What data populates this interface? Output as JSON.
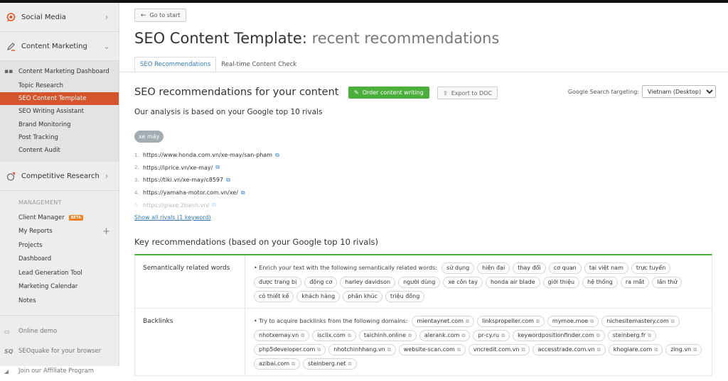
{
  "sidebar": {
    "top_items": [
      {
        "label": "Social Media",
        "icon": "speech-bubble-icon",
        "chevron": "›"
      },
      {
        "label": "Content Marketing",
        "icon": "pencil-icon",
        "chevron": "⌄"
      }
    ],
    "content_marketing_items": [
      {
        "label": "Content Marketing Dashboard",
        "icon": "grid-icon"
      },
      {
        "label": "Topic Research"
      },
      {
        "label": "SEO Content Template",
        "active": true
      },
      {
        "label": "SEO Writing Assistant"
      },
      {
        "label": "Brand Monitoring"
      },
      {
        "label": "Post Tracking"
      },
      {
        "label": "Content Audit"
      }
    ],
    "competitive": {
      "label": "Competitive Research",
      "icon": "pie-chart-icon",
      "chevron": "›"
    },
    "management": {
      "heading": "MANAGEMENT",
      "items": [
        {
          "label": "Client Manager",
          "badge": "BETA"
        },
        {
          "label": "My Reports",
          "action": "+"
        },
        {
          "label": "Projects"
        },
        {
          "label": "Dashboard"
        },
        {
          "label": "Lead Generation Tool"
        },
        {
          "label": "Marketing Calendar"
        },
        {
          "label": "Notes"
        }
      ]
    },
    "bottom_items": [
      {
        "label": "Online demo",
        "icon": "monitor-icon",
        "glyph": "▭"
      },
      {
        "label": "SEOquake for your browser",
        "icon": "seoquake-icon",
        "glyph": "SQ"
      },
      {
        "label": "Join our Affiliate Program",
        "icon": "megaphone-icon",
        "glyph": "◢"
      }
    ]
  },
  "main": {
    "back_label": "Go to start",
    "title_main": "SEO Content Template:",
    "title_sub": "recent recommendations",
    "tabs": [
      {
        "label": "SEO Recommendations",
        "active": true
      },
      {
        "label": "Real-time Content Check"
      }
    ],
    "section_title": "SEO recommendations for your content",
    "order_label": "Order content writing",
    "export_label": "Export to DOC",
    "targeting_label": "Google Search targeting:",
    "targeting_value": "Vietnam (Desktop)",
    "analysis_text": "Our analysis is based on your Google top 10 rivals",
    "keyword": "xe máy",
    "rivals": [
      "https://www.honda.com.vn/xe-may/san-pham",
      "https://iprice.vn/xe-may/",
      "https://tiki.vn/xe-may/c8597",
      "https://yamaha-motor.com.vn/xe/",
      "https://giaxe.2banh.vn/"
    ],
    "show_all_label": "Show all rivals (1 keyword)",
    "key_title": "Key recommendations (based on your Google top 10 rivals)",
    "semantic": {
      "label": "Semantically related words",
      "intro": "• Enrich your text with the following semantically related words:",
      "words": [
        "sử dụng",
        "hiện đại",
        "thay đổi",
        "cơ quan",
        "tại việt nam",
        "trực tuyến",
        "được trang bị",
        "động cơ",
        "harley davidson",
        "người dùng",
        "xe côn tay",
        "honda air blade",
        "giới thiệu",
        "hệ thống",
        "ra mắt",
        "lần thứ",
        "có thiết kế",
        "khách hàng",
        "phân khúc",
        "triệu đồng"
      ]
    },
    "backlinks": {
      "label": "Backlinks",
      "intro": "• Try to acquire backlinks from the following domains:",
      "domains": [
        "mientaynet.com",
        "linkspropeller.com",
        "mymoe.moe",
        "nichesitemastery.com",
        "nhotxemay.vn",
        "isclix.com",
        "taichinh.online",
        "alerank.com",
        "pr-cy.ru",
        "keywordpositionfinder.com",
        "steinberg.fr",
        "php5developer.com",
        "nhotchinhhang.vn",
        "website-scan.com",
        "vncredit.com.vn",
        "accesstrade.com.vn",
        "khogiare.com",
        "zing.vn",
        "azibai.com",
        "steinberg.net"
      ]
    }
  }
}
